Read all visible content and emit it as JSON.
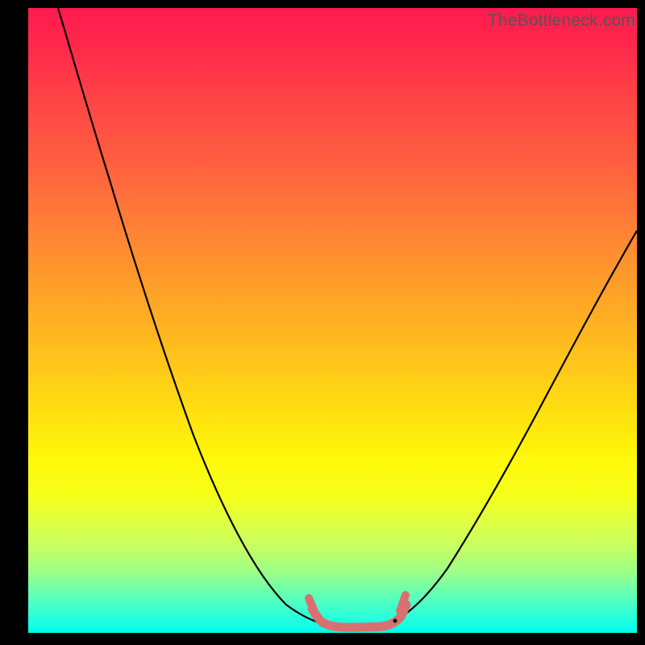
{
  "watermark": "TheBottleneck.com",
  "chart_data": {
    "type": "line",
    "title": "",
    "xlabel": "",
    "ylabel": "",
    "xlim": [
      0,
      100
    ],
    "ylim": [
      0,
      100
    ],
    "series": [
      {
        "name": "bottleneck-curve",
        "x": [
          5,
          10,
          15,
          20,
          25,
          30,
          35,
          40,
          45,
          48,
          50,
          52,
          54,
          56,
          58,
          60,
          62,
          65,
          70,
          75,
          80,
          85,
          90,
          95,
          100
        ],
        "values": [
          100,
          89,
          78,
          66,
          55,
          44,
          33,
          22,
          10,
          4,
          1,
          0,
          0,
          0,
          0,
          0,
          2,
          6,
          14,
          23,
          32,
          41,
          49,
          56,
          63
        ]
      },
      {
        "name": "plateau-marker",
        "x": [
          47,
          49,
          51,
          53,
          55,
          57,
          59,
          61,
          62
        ],
        "values": [
          3,
          1.5,
          1,
          1,
          1,
          1,
          1.2,
          2,
          3.5
        ]
      }
    ],
    "colors": {
      "curve": "#000000",
      "marker": "#d87070",
      "gradient_top": "#ff1a4f",
      "gradient_bottom": "#00f8dd"
    }
  }
}
